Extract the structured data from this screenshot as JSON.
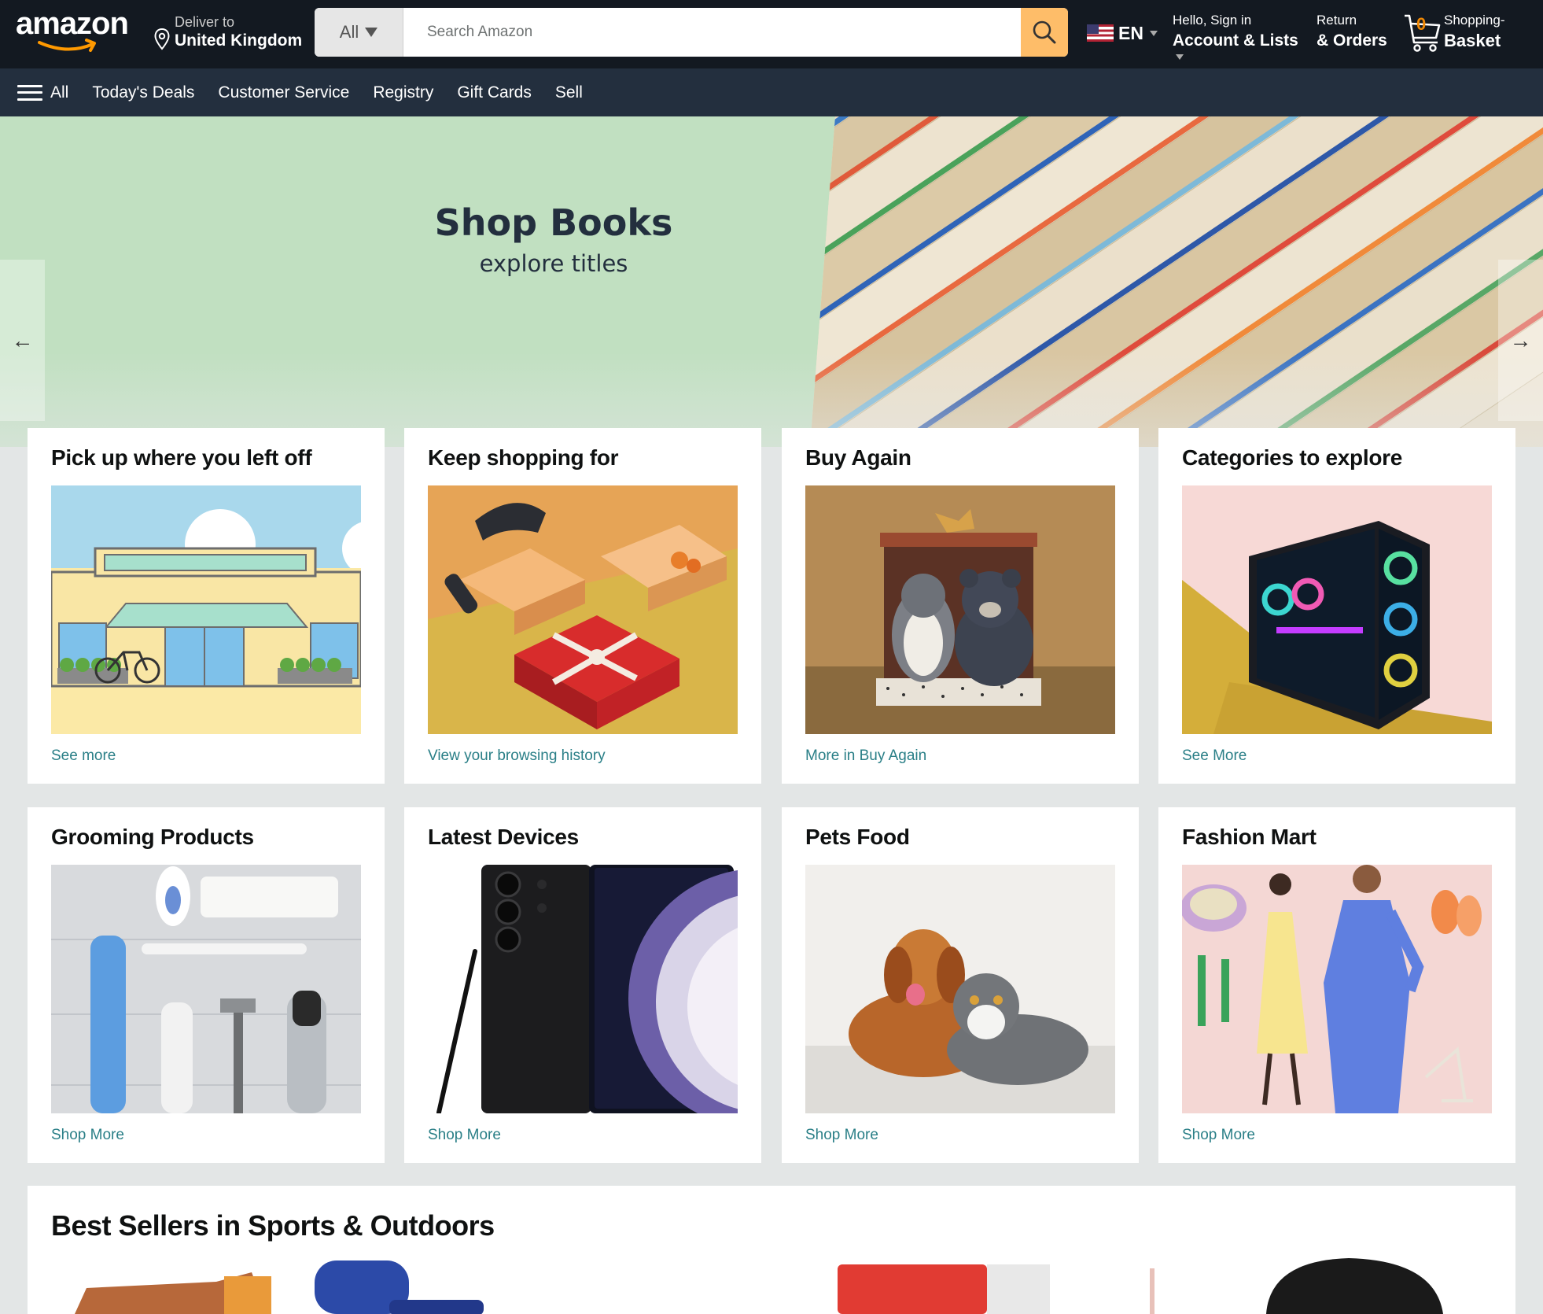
{
  "header": {
    "logo": "amazon",
    "deliver": {
      "line1": "Deliver to",
      "line2": "United Kingdom"
    },
    "search": {
      "category": "All",
      "placeholder": "Search Amazon"
    },
    "language": "EN",
    "account": {
      "line1": "Hello, Sign in",
      "line2": "Account & Lists"
    },
    "returns": {
      "line1": "Return",
      "line2": "& Orders"
    },
    "cart": {
      "count": "0",
      "line1": "Shopping-",
      "line2": "Basket"
    }
  },
  "nav": {
    "all": "All",
    "items": [
      "Today's Deals",
      "Customer Service",
      "Registry",
      "Gift Cards",
      "Sell"
    ]
  },
  "hero": {
    "title": "Shop Books",
    "subtitle": "explore titles",
    "prev": "←",
    "next": "→"
  },
  "cards": [
    {
      "title": "Pick up where you left off",
      "link": "See more"
    },
    {
      "title": "Keep shopping for",
      "link": "View your browsing history"
    },
    {
      "title": "Buy Again",
      "link": "More in Buy Again"
    },
    {
      "title": "Categories to explore",
      "link": "See More"
    },
    {
      "title": "Grooming Products",
      "link": "Shop More"
    },
    {
      "title": "Latest Devices",
      "link": "Shop More"
    },
    {
      "title": "Pets Food",
      "link": "Shop More"
    },
    {
      "title": "Fashion Mart",
      "link": "Shop More"
    }
  ],
  "best_sellers": {
    "title": "Best Sellers in Sports & Outdoors"
  },
  "colors": {
    "nav_top": "#131921",
    "nav_main": "#232f3e",
    "search_button": "#febd69",
    "hero_bg": "#c1e0c1",
    "link": "#2a7f87",
    "page_bg": "#e3e6e6"
  }
}
